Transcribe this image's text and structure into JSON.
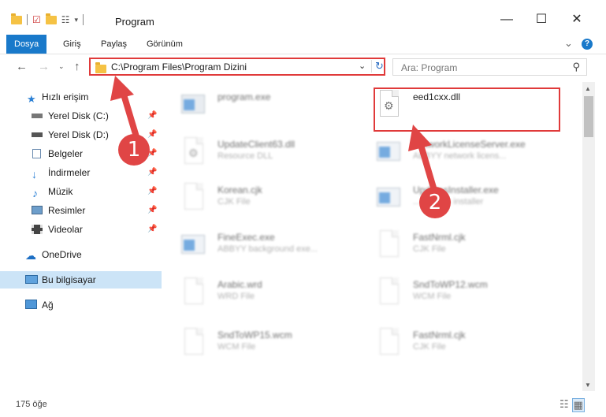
{
  "window": {
    "title": "Program",
    "minimize": "—",
    "maximize": "☐",
    "close": "✕"
  },
  "ribbon": {
    "tabs": [
      "Dosya",
      "Giriş",
      "Paylaş",
      "Görünüm"
    ],
    "collapse": "⌄",
    "help": "?"
  },
  "address": {
    "path": "C:\\Program Files\\Program Dizini"
  },
  "search": {
    "placeholder": "Ara: Program"
  },
  "sidebar": {
    "items": [
      {
        "label": "Hızlı erişim",
        "pinned": false
      },
      {
        "label": "Yerel Disk (C:)",
        "pinned": true
      },
      {
        "label": "Yerel Disk (D:)",
        "pinned": true
      },
      {
        "label": "Belgeler",
        "pinned": true
      },
      {
        "label": "İndirmeler",
        "pinned": true
      },
      {
        "label": "Müzik",
        "pinned": true
      },
      {
        "label": "Resimler",
        "pinned": true
      },
      {
        "label": "Videolar",
        "pinned": true
      },
      {
        "label": "OneDrive",
        "pinned": false
      },
      {
        "label": "Bu bilgisayar",
        "pinned": false,
        "selected": true
      },
      {
        "label": "Ağ",
        "pinned": false
      }
    ]
  },
  "files": [
    {
      "name": "program.exe",
      "type": ""
    },
    {
      "name": "eed1cxx.dll",
      "type": ""
    },
    {
      "name": "UpdateClient63.dll",
      "type": "Resource DLL"
    },
    {
      "name": "NetworkLicenseServer.exe",
      "type": "ABBYY network licens..."
    },
    {
      "name": "Korean.cjk",
      "type": "CJK File"
    },
    {
      "name": "UpdatesInstaller.exe",
      "type": "...updates installer"
    },
    {
      "name": "FineExec.exe",
      "type": "ABBYY background exe..."
    },
    {
      "name": "FastNrml.cjk",
      "type": "CJK File"
    },
    {
      "name": "Arabic.wrd",
      "type": "WRD File"
    },
    {
      "name": "SndToWP12.wcm",
      "type": "WCM File"
    },
    {
      "name": "SndToWP15.wcm",
      "type": "WCM File"
    },
    {
      "name": "FastNrml.cjk",
      "type": "CJK File"
    }
  ],
  "status": {
    "count": "175 öğe"
  },
  "annotations": {
    "badge1": "1",
    "badge2": "2"
  },
  "colors": {
    "accent": "#1979ca",
    "highlight": "#e03a3a",
    "selected": "#cce4f7"
  }
}
